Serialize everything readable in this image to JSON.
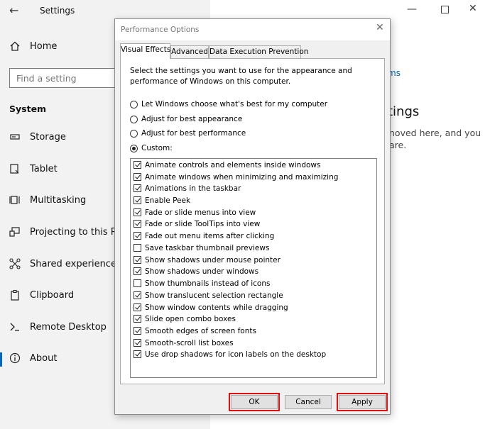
{
  "settings": {
    "title": "Settings",
    "search_placeholder": "Find a setting",
    "section": "System",
    "nav": [
      {
        "label": "Home",
        "icon": "home-icon"
      },
      {
        "label": "Storage",
        "icon": "storage-icon"
      },
      {
        "label": "Tablet",
        "icon": "tablet-icon"
      },
      {
        "label": "Multitasking",
        "icon": "multitasking-icon"
      },
      {
        "label": "Projecting to this PC",
        "icon": "projecting-icon"
      },
      {
        "label": "Shared experiences",
        "icon": "shared-experiences-icon"
      },
      {
        "label": "Clipboard",
        "icon": "clipboard-icon"
      },
      {
        "label": "Remote Desktop",
        "icon": "remote-desktop-icon"
      },
      {
        "label": "About",
        "icon": "about-icon"
      }
    ]
  },
  "background": {
    "link_fragment": "ms",
    "heading_fragment": "tings",
    "text_line1": "noved here, and you",
    "text_line2": "are."
  },
  "dialog": {
    "title": "Performance Options",
    "tabs": [
      "Visual Effects",
      "Advanced",
      "Data Execution Prevention"
    ],
    "selected_tab": "Visual Effects",
    "description": "Select the settings you want to use for the appearance and performance of Windows on this computer.",
    "radios": [
      {
        "label": "Let Windows choose what's best for my computer",
        "checked": false
      },
      {
        "label": "Adjust for best appearance",
        "checked": false
      },
      {
        "label": "Adjust for best performance",
        "checked": false
      },
      {
        "label": "Custom:",
        "checked": true
      }
    ],
    "options": [
      {
        "label": "Animate controls and elements inside windows",
        "checked": true
      },
      {
        "label": "Animate windows when minimizing and maximizing",
        "checked": true
      },
      {
        "label": "Animations in the taskbar",
        "checked": true
      },
      {
        "label": "Enable Peek",
        "checked": true
      },
      {
        "label": "Fade or slide menus into view",
        "checked": true
      },
      {
        "label": "Fade or slide ToolTips into view",
        "checked": true
      },
      {
        "label": "Fade out menu items after clicking",
        "checked": true
      },
      {
        "label": "Save taskbar thumbnail previews",
        "checked": false
      },
      {
        "label": "Show shadows under mouse pointer",
        "checked": true
      },
      {
        "label": "Show shadows under windows",
        "checked": true
      },
      {
        "label": "Show thumbnails instead of icons",
        "checked": false
      },
      {
        "label": "Show translucent selection rectangle",
        "checked": true
      },
      {
        "label": "Show window contents while dragging",
        "checked": true
      },
      {
        "label": "Slide open combo boxes",
        "checked": true
      },
      {
        "label": "Smooth edges of screen fonts",
        "checked": true
      },
      {
        "label": "Smooth-scroll list boxes",
        "checked": true
      },
      {
        "label": "Use drop shadows for icon labels on the desktop",
        "checked": true
      }
    ],
    "buttons": {
      "ok": "OK",
      "cancel": "Cancel",
      "apply": "Apply"
    }
  },
  "colors": {
    "accent": "#0067c0",
    "highlight": "#e01010"
  }
}
